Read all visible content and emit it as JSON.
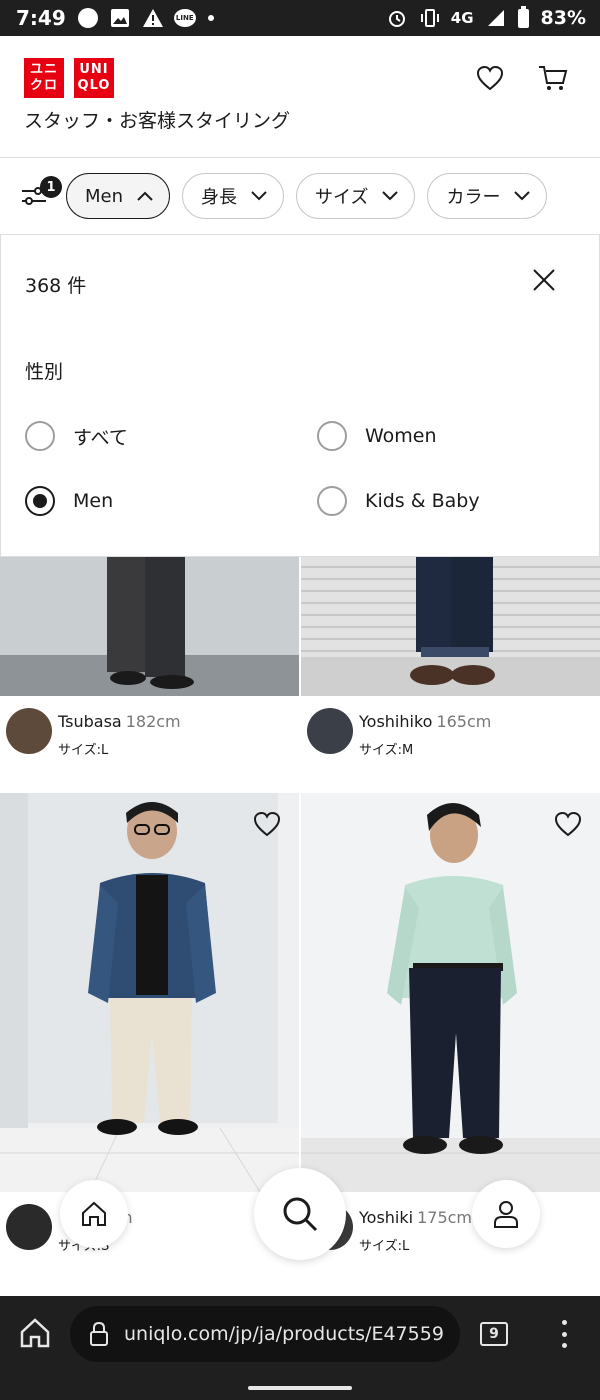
{
  "status_bar": {
    "time": "7:49",
    "network": "4G",
    "battery": "83%",
    "line_app": "LINE",
    "icons": [
      "spotify-icon",
      "gallery-icon",
      "warning-icon",
      "line-icon",
      "dot-icon",
      "alarm-icon",
      "vibrate-icon",
      "signal-icon",
      "battery-icon"
    ]
  },
  "header": {
    "logo_top": [
      "ユニ",
      "クロ"
    ],
    "logo_bottom": [
      "UNI",
      "QLO"
    ],
    "subtitle": "スタッフ・お客様スタイリング",
    "icons": [
      "heart-icon",
      "cart-icon"
    ]
  },
  "filter_bar": {
    "badge_count": "1",
    "chips": [
      {
        "label": "Men",
        "active": true
      },
      {
        "label": "身長",
        "active": false
      },
      {
        "label": "サイズ",
        "active": false
      },
      {
        "label": "カラー",
        "active": false
      }
    ]
  },
  "panel": {
    "count": "368 件",
    "section_label": "性別",
    "options": [
      {
        "label": "すべて",
        "checked": false
      },
      {
        "label": "Women",
        "checked": false
      },
      {
        "label": "Men",
        "checked": true
      },
      {
        "label": "Kids & Baby",
        "checked": false
      }
    ]
  },
  "cards": [
    {
      "name": "Tsubasa",
      "height": "182cm",
      "size": "サイズ:L"
    },
    {
      "name": "Yoshihiko",
      "height": "165cm",
      "size": "サイズ:M"
    },
    {
      "name": "",
      "height": "4cm",
      "size": "サイズ:S"
    },
    {
      "name": "Yoshiki",
      "height": "175cm",
      "size": "サイズ:L"
    }
  ],
  "browser": {
    "url": "uniqlo.com/jp/ja/products/E47559",
    "tab_count": "9"
  },
  "colors": {
    "brand_red": "#e60012",
    "text": "#1b1b1b",
    "browser_bg": "#1f1f1f"
  }
}
